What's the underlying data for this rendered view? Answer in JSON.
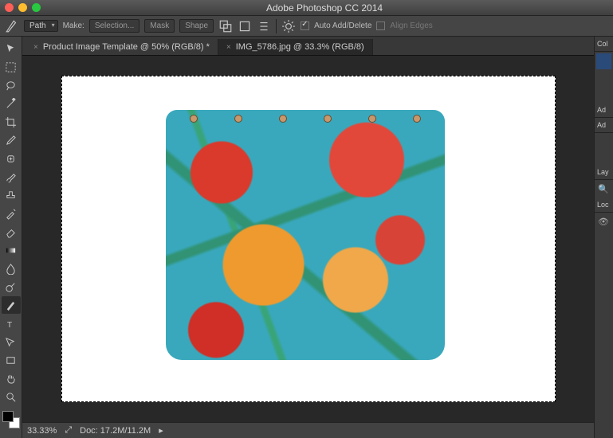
{
  "app": {
    "title": "Adobe Photoshop CC 2014"
  },
  "options": {
    "mode_label": "Path",
    "make_label": "Make:",
    "btn_selection": "Selection...",
    "btn_mask": "Mask",
    "btn_shape": "Shape",
    "auto_add_delete": "Auto Add/Delete",
    "align_edges": "Align Edges"
  },
  "tabs": [
    {
      "label": "Product Image Template @ 50% (RGB/8) *",
      "active": false
    },
    {
      "label": "IMG_5786.jpg @ 33.3% (RGB/8)",
      "active": true
    }
  ],
  "tools": [
    "move",
    "marquee",
    "lasso",
    "wand",
    "crop",
    "eyedropper",
    "heal",
    "brush",
    "stamp",
    "history",
    "eraser",
    "gradient",
    "blur",
    "dodge",
    "pen",
    "type",
    "path",
    "rect",
    "hand",
    "zoom"
  ],
  "right_panels": {
    "color": "Col",
    "adjustments_a": "Ad",
    "adjustments_b": "Ad",
    "layers": "Lay",
    "lock": "Loc"
  },
  "status": {
    "zoom": "33.33%",
    "doc": "Doc: 17.2M/11.2M"
  },
  "colors": {
    "canvas_bg": "#ffffff",
    "workspace": "#282828",
    "panel": "#404040"
  }
}
